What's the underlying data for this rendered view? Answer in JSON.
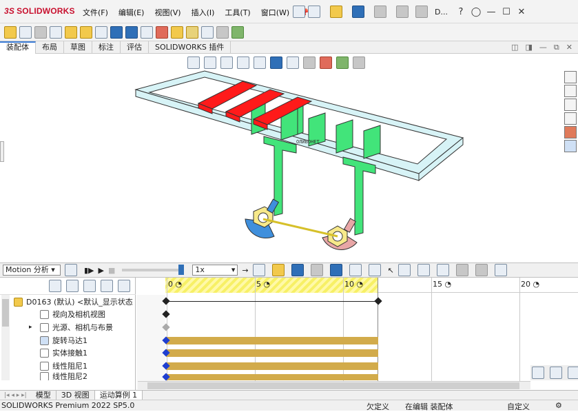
{
  "app": {
    "logo_prefix": "3S",
    "logo_name": "SOLIDWORKS",
    "title_partial": "D..."
  },
  "menu": [
    "文件(F)",
    "编辑(E)",
    "视图(V)",
    "插入(I)",
    "工具(T)",
    "窗口(W)"
  ],
  "command_tabs": [
    {
      "label": "装配体",
      "active": true
    },
    {
      "label": "布局",
      "active": false
    },
    {
      "label": "草图",
      "active": false
    },
    {
      "label": "标注",
      "active": false
    },
    {
      "label": "评估",
      "active": false
    },
    {
      "label": "SOLIDWORKS 插件",
      "active": false
    }
  ],
  "motion": {
    "study_type": "Motion 分析",
    "speed": "1x"
  },
  "timeline": {
    "ticks": [
      "0",
      "5",
      "10",
      "15",
      "20"
    ],
    "tick_unit_icon": "clock-icon"
  },
  "tree": {
    "root": "D0163 (默认) <默认_显示状态",
    "items": [
      {
        "label": "视向及相机视图",
        "icon": "camera-view-icon"
      },
      {
        "label": "光源、相机与布景",
        "icon": "lights-icon"
      },
      {
        "label": "旋转马达1",
        "icon": "rotary-motor-icon"
      },
      {
        "label": "实体接触1",
        "icon": "contact-icon"
      },
      {
        "label": "线性阻尼1",
        "icon": "damper-icon"
      },
      {
        "label": "线性阻尼2",
        "icon": "damper-icon"
      }
    ]
  },
  "model_text": "ОЛИБОНЕТ",
  "bottom_tabs": [
    {
      "label": "模型",
      "active": false
    },
    {
      "label": "3D 视图",
      "active": false
    },
    {
      "label": "运动算例 1",
      "active": true
    }
  ],
  "status": {
    "version": "SOLIDWORKS Premium 2022 SP5.0",
    "definition": "欠定义",
    "editing": "在编辑 装配体",
    "custom": "自定义"
  },
  "colors": {
    "accent": "#3a7bd5",
    "frame": "#d7f3f6",
    "blocks": "#ff1a1a",
    "arms": "#42e47a",
    "timeline_hatch": "#f7f066",
    "bar": "#d2ab4b",
    "keyframe": "#1f3fd0"
  }
}
